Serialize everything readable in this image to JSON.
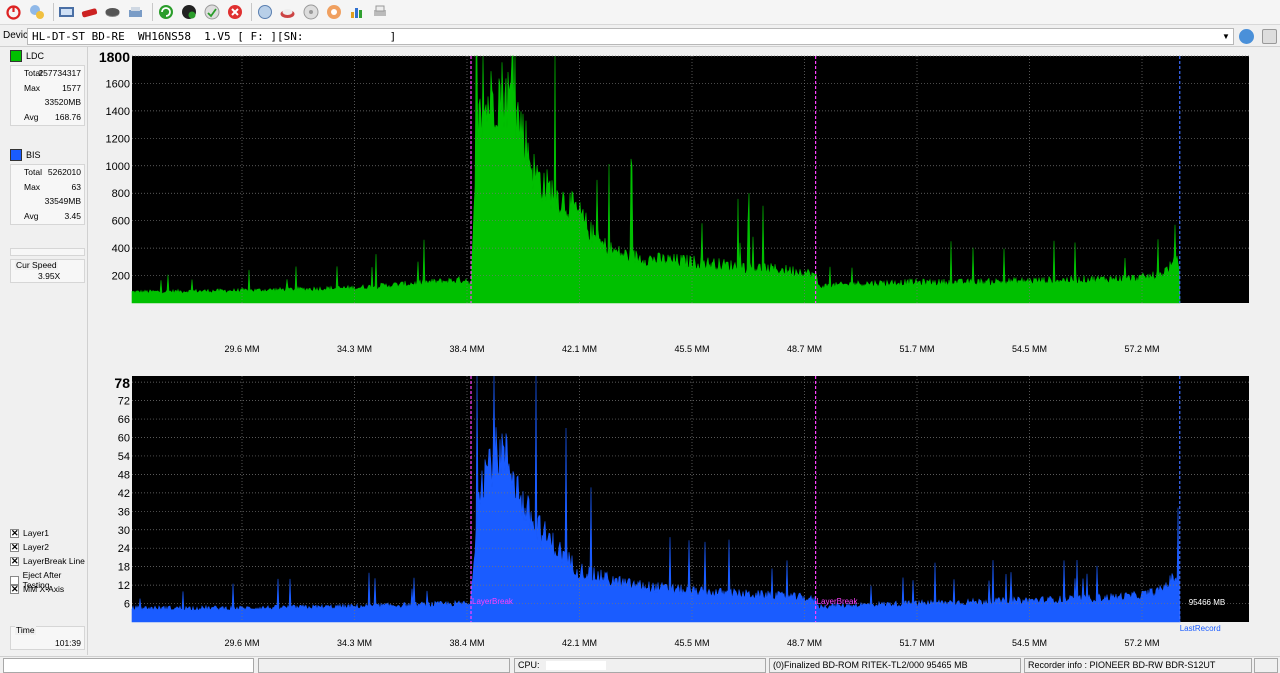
{
  "toolbar": {
    "icons": [
      "power-icon",
      "disc-info-icon",
      "device-icon",
      "erase-icon",
      "eject-icon",
      "copy-icon",
      "refresh-icon",
      "disc-black-icon",
      "disc-check-icon",
      "stop-icon",
      "circle-icon",
      "scan-icon",
      "save-icon",
      "config-icon",
      "graph-icon",
      "printer-icon"
    ]
  },
  "device": {
    "label": "Device:",
    "value": "HL-DT-ST BD-RE  WH16NS58  1.V5 [ F: ][SN:             ]"
  },
  "ldc": {
    "name": "LDC",
    "color": "#00c000",
    "stats": [
      {
        "key": "Total",
        "value": "257734317"
      },
      {
        "key": "Max",
        "value": "1577"
      },
      {
        "key": "",
        "value": "33520MB"
      },
      {
        "key": "Avg",
        "value": "168.76"
      }
    ]
  },
  "bis": {
    "name": "BIS",
    "color": "#1a5cff",
    "stats": [
      {
        "key": "Total",
        "value": "5262010"
      },
      {
        "key": "Max",
        "value": "63"
      },
      {
        "key": "",
        "value": "33549MB"
      },
      {
        "key": "Avg",
        "value": "3.45"
      }
    ]
  },
  "cur_speed": {
    "label": "Cur Speed",
    "value": "3.95X"
  },
  "options": [
    {
      "label": "Layer1",
      "checked": true
    },
    {
      "label": "Layer2",
      "checked": true
    },
    {
      "label": "LayerBreak Line",
      "checked": true
    },
    {
      "label": "Eject After Testing",
      "checked": false
    },
    {
      "label": "MM X-Axis",
      "checked": true
    }
  ],
  "time": {
    "label": "Time",
    "value": "101:39"
  },
  "chart_data": [
    {
      "type": "area",
      "series": [
        {
          "name": "LDC",
          "color": "#00c000"
        }
      ],
      "x_ticks": [
        "29.6 MM",
        "34.3 MM",
        "38.4 MM",
        "42.1 MM",
        "45.5 MM",
        "48.7 MM",
        "51.7 MM",
        "54.5 MM",
        "57.2 MM"
      ],
      "y_ticks": [
        "200",
        "400",
        "600",
        "800",
        "1000",
        "1200",
        "1400",
        "1600",
        "1800"
      ],
      "ylim": [
        0,
        1800
      ],
      "profile_x": [
        0.0,
        0.05,
        0.1,
        0.2,
        0.3,
        0.3035,
        0.31,
        0.32,
        0.33,
        0.34,
        0.35,
        0.36,
        0.37,
        0.38,
        0.39,
        0.4,
        0.41,
        0.42,
        0.43,
        0.44,
        0.46,
        0.5,
        0.55,
        0.6,
        0.612,
        0.615,
        0.65,
        0.7,
        0.75,
        0.8,
        0.85,
        0.9,
        0.92,
        0.935,
        0.938,
        0.94
      ],
      "profile_y": [
        80,
        85,
        90,
        110,
        170,
        130,
        1300,
        1480,
        1550,
        1480,
        1250,
        950,
        850,
        780,
        720,
        650,
        520,
        430,
        380,
        350,
        320,
        300,
        260,
        230,
        200,
        120,
        140,
        150,
        150,
        160,
        170,
        180,
        200,
        300,
        260,
        0
      ],
      "layer_breaks": [
        0.3035,
        0.612
      ],
      "end_marker": 0.938,
      "grid": true
    },
    {
      "type": "area",
      "series": [
        {
          "name": "BIS",
          "color": "#1a5cff"
        }
      ],
      "x_ticks": [
        "29.6 MM",
        "34.3 MM",
        "38.4 MM",
        "42.1 MM",
        "45.5 MM",
        "48.7 MM",
        "51.7 MM",
        "54.5 MM",
        "57.2 MM"
      ],
      "y_ticks": [
        "6",
        "12",
        "18",
        "24",
        "30",
        "36",
        "42",
        "48",
        "54",
        "60",
        "66",
        "72",
        "78"
      ],
      "ylim": [
        0,
        80
      ],
      "profile_x": [
        0.0,
        0.05,
        0.1,
        0.2,
        0.3,
        0.3035,
        0.31,
        0.32,
        0.33,
        0.34,
        0.35,
        0.36,
        0.37,
        0.38,
        0.39,
        0.4,
        0.41,
        0.42,
        0.43,
        0.44,
        0.46,
        0.5,
        0.55,
        0.6,
        0.612,
        0.615,
        0.65,
        0.7,
        0.75,
        0.8,
        0.85,
        0.9,
        0.92,
        0.935,
        0.938,
        0.94
      ],
      "profile_y": [
        4.5,
        4.5,
        4.5,
        5,
        6,
        5,
        45,
        52,
        56,
        50,
        38,
        32,
        28,
        24,
        20,
        17,
        15.5,
        14.5,
        13.5,
        12.5,
        11.5,
        10,
        9,
        8,
        7,
        5,
        5.5,
        6,
        6.5,
        7,
        7.5,
        8.5,
        10,
        15,
        12,
        0
      ],
      "layer_breaks": [
        0.3035,
        0.612
      ],
      "end_marker": 0.938,
      "grid": true,
      "layer_break_label": "LayerBreak",
      "size_label": "95466 MB",
      "last_record_label": "LastRecord"
    }
  ],
  "status": {
    "cells": [
      "",
      "",
      "CPU:",
      "(0)Finalized  BD-ROM  RITEK-TL2/000  95465 MB",
      "Recorder info : PIONEER      BD-RW   BDR-S12UT",
      ""
    ]
  }
}
